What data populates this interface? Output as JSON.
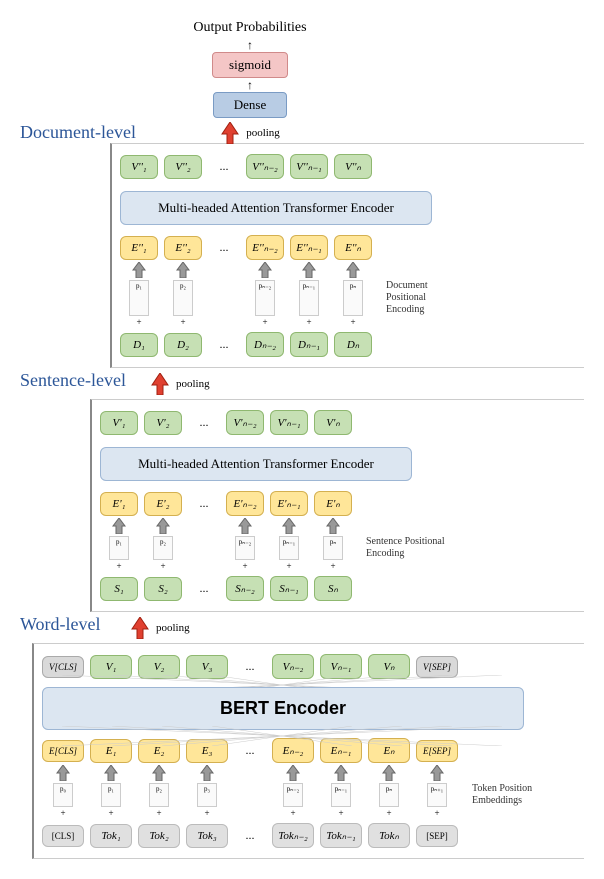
{
  "output_label": "Output Probabilities",
  "sigmoid": "sigmoid",
  "dense": "Dense",
  "pooling": "pooling",
  "levels": {
    "document": "Document-level",
    "sentence": "Sentence-level",
    "word": "Word-level"
  },
  "encoder_label": "Multi-headed Attention Transformer Encoder",
  "bert_label": "BERT Encoder",
  "side_labels": {
    "doc_pe": "Document Positional Encoding",
    "sent_pe": "Sentence Positional Encoding",
    "tok_pe": "Token Position Embeddings"
  },
  "dots": "...",
  "doc": {
    "v": [
      "V''₁",
      "V''₂",
      "V''ₙ₋₂",
      "V''ₙ₋₁",
      "V''ₙ"
    ],
    "e": [
      "E''₁",
      "E''₂",
      "E''ₙ₋₂",
      "E''ₙ₋₁",
      "E''ₙ"
    ],
    "d": [
      "D₁",
      "D₂",
      "Dₙ₋₂",
      "Dₙ₋₁",
      "Dₙ"
    ],
    "p": [
      "p₁",
      "p₂",
      "pₙ₋₂",
      "pₙ₋₁",
      "pₙ"
    ]
  },
  "sent": {
    "v": [
      "V'₁",
      "V'₂",
      "V'ₙ₋₂",
      "V'ₙ₋₁",
      "V'ₙ"
    ],
    "e": [
      "E'₁",
      "E'₂",
      "E'ₙ₋₂",
      "E'ₙ₋₁",
      "E'ₙ"
    ],
    "s": [
      "S₁",
      "S₂",
      "Sₙ₋₂",
      "Sₙ₋₁",
      "Sₙ"
    ],
    "p": [
      "p₁",
      "p₂",
      "pₙ₋₂",
      "pₙ₋₁",
      "pₙ"
    ]
  },
  "word": {
    "v_cls": "V[CLS]",
    "v": [
      "V₁",
      "V₂",
      "V₃",
      "Vₙ₋₂",
      "Vₙ₋₁",
      "Vₙ"
    ],
    "v_sep": "V[SEP]",
    "e_cls": "E[CLS]",
    "e": [
      "E₁",
      "E₂",
      "E₃",
      "Eₙ₋₂",
      "Eₙ₋₁",
      "Eₙ"
    ],
    "e_sep": "E[SEP]",
    "tok_cls": "[CLS]",
    "tok": [
      "Tok₁",
      "Tok₂",
      "Tok₃",
      "Tokₙ₋₂",
      "Tokₙ₋₁",
      "Tokₙ"
    ],
    "tok_sep": "[SEP]",
    "p": [
      "p₀",
      "p₁",
      "p₂",
      "p₃",
      "pₙ₋₂",
      "pₙ₋₁",
      "pₙ",
      "pₙ₊₁"
    ]
  },
  "chart_data": {
    "type": "diagram",
    "description": "Hierarchical transformer architecture with three levels (word, sentence, document). Each level applies positional encoding, a transformer encoder, and pooling to pass representations upward. Word-level uses BERT Encoder. Final output passes through Dense + sigmoid to produce probabilities.",
    "levels": [
      "Word-level",
      "Sentence-level",
      "Document-level"
    ],
    "flow": "Tokens → BERT Encoder → pooling → Sentence embeddings → Transformer Encoder → pooling → Document embeddings → Transformer Encoder → pooling → Dense → sigmoid → Output Probabilities"
  }
}
